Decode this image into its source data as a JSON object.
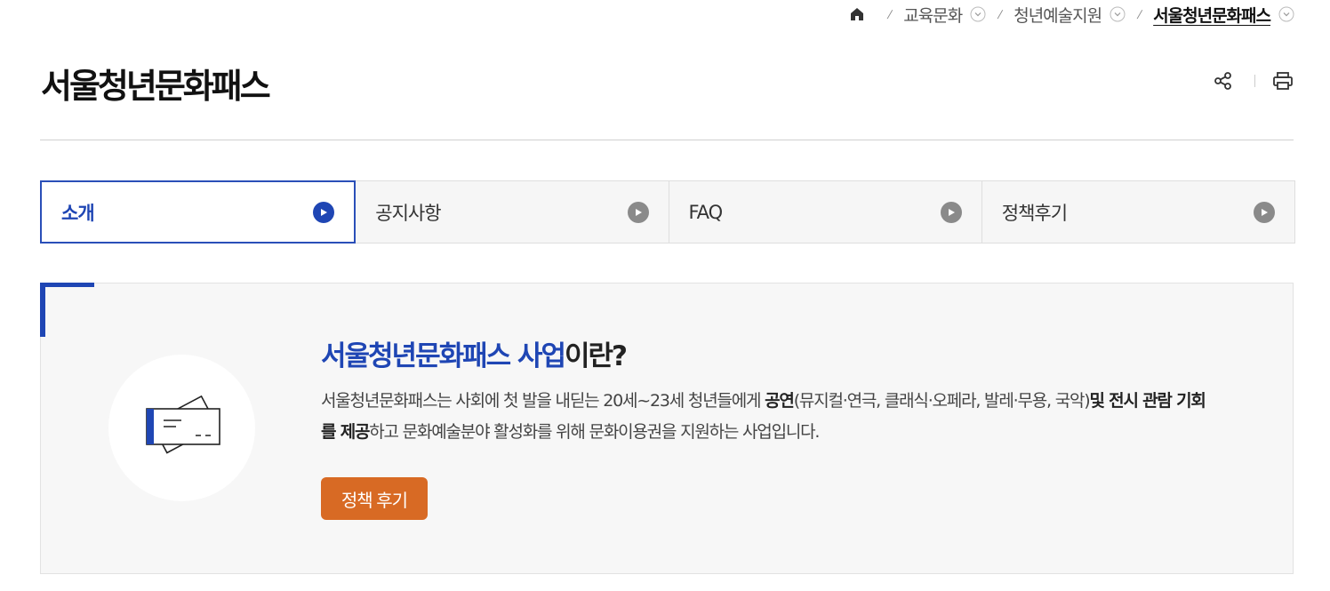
{
  "breadcrumb": {
    "items": [
      {
        "label": "교육문화"
      },
      {
        "label": "청년예술지원"
      },
      {
        "label": "서울청년문화패스"
      }
    ]
  },
  "page": {
    "title": "서울청년문화패스"
  },
  "tabs": [
    {
      "label": "소개",
      "active": true
    },
    {
      "label": "공지사항",
      "active": false
    },
    {
      "label": "FAQ",
      "active": false
    },
    {
      "label": "정책후기",
      "active": false
    }
  ],
  "intro": {
    "heading_accent": "서울청년문화패스 사업",
    "heading_rest": "이란?",
    "desc_1": "서울청년문화패스는 사회에 첫 발을 내딛는 20세~23세 청년들에게 ",
    "desc_bold_1": "공연",
    "desc_2": "(뮤지컬·연극, 클래식·오페라, 발레·무용, 국악)",
    "desc_bold_2": "및 전시 관람 기회를 제공",
    "desc_3": "하고 문화예술분야 활성화를 위해 문화이용권을 지원하는 사업입니다.",
    "button_label": "정책 후기"
  },
  "colors": {
    "accent": "#1f46b4",
    "button": "#d86a24",
    "tab_inactive_bg": "#f6f6f6",
    "intro_bg": "#f7f7f7"
  },
  "icons": {
    "home": "home-icon",
    "chevron": "chevron-down-circle-icon",
    "share": "share-icon",
    "print": "print-icon",
    "tab_arrow": "play-circle-icon",
    "ticket": "ticket-icon"
  }
}
